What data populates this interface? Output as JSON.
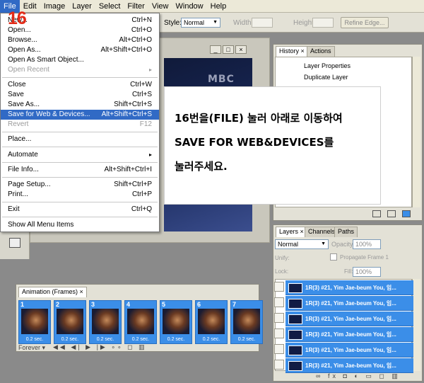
{
  "menubar": {
    "items": [
      "File",
      "Edit",
      "Image",
      "Layer",
      "Select",
      "Filter",
      "View",
      "Window",
      "Help"
    ]
  },
  "options": {
    "style_label": "Style:",
    "style_value": "Normal",
    "width_label": "Width:",
    "height_label": "Height:",
    "refine_edge": "Refine Edge..."
  },
  "file_menu": {
    "items": [
      {
        "label": "New...",
        "shortcut": "Ctrl+N"
      },
      {
        "label": "Open...",
        "shortcut": "Ctrl+O"
      },
      {
        "label": "Browse...",
        "shortcut": "Alt+Ctrl+O"
      },
      {
        "label": "Open As...",
        "shortcut": "Alt+Shift+Ctrl+O"
      },
      {
        "label": "Open As Smart Object...",
        "shortcut": ""
      },
      {
        "label": "Open Recent",
        "shortcut": "▸"
      },
      {
        "label": "Close",
        "shortcut": "Ctrl+W"
      },
      {
        "label": "Save",
        "shortcut": "Ctrl+S"
      },
      {
        "label": "Save As...",
        "shortcut": "Shift+Ctrl+S"
      },
      {
        "label": "Save for Web & Devices...",
        "shortcut": "Alt+Shift+Ctrl+S"
      },
      {
        "label": "Revert",
        "shortcut": "F12"
      },
      {
        "label": "Place...",
        "shortcut": ""
      },
      {
        "label": "Automate",
        "shortcut": "▸"
      },
      {
        "label": "File Info...",
        "shortcut": "Alt+Shift+Ctrl+I"
      },
      {
        "label": "Page Setup...",
        "shortcut": "Shift+Ctrl+P"
      },
      {
        "label": "Print...",
        "shortcut": "Ctrl+P"
      },
      {
        "label": "Exit",
        "shortcut": "Ctrl+Q"
      },
      {
        "label": "Show All Menu Items",
        "shortcut": ""
      }
    ]
  },
  "badge": "16",
  "callout": {
    "line1": "16번을(FILE) 눌러 아래로 이동하여",
    "line2": "SAVE FOR WEB&DEVICES를",
    "line3": "눌러주세요."
  },
  "history_panel": {
    "tabs": [
      "History",
      "Actions"
    ],
    "rows": [
      "Layer Properties",
      "Duplicate Layer"
    ]
  },
  "layers_panel": {
    "tabs": [
      "Layers",
      "Channels",
      "Paths"
    ],
    "blend_mode": "Normal",
    "opacity_label": "Opacity:",
    "opacity_value": "100%",
    "unify_label": "Unify:",
    "propagate_label": "Propagate Frame 1",
    "lock_label": "Lock:",
    "fill_label": "Fill:",
    "fill_value": "100%",
    "layers": [
      "1R(3) #21, Yim Jae-beum  You, 임...",
      "1R(3) #21, Yim Jae-beum  You, 임...",
      "1R(3) #21, Yim Jae-beum  You, 임...",
      "1R(3) #21, Yim Jae-beum  You, 임...",
      "1R(3) #21, Yim Jae-beum  You, 임...",
      "1R(3) #21, Yim Jae-beum  You, 임..."
    ]
  },
  "animation_panel": {
    "title": "Animation (Frames)",
    "frames": [
      {
        "num": "1",
        "delay": "0.2 sec."
      },
      {
        "num": "2",
        "delay": "0.2 sec."
      },
      {
        "num": "3",
        "delay": "0.2 sec."
      },
      {
        "num": "4",
        "delay": "0.2 sec."
      },
      {
        "num": "5",
        "delay": "0.2 sec."
      },
      {
        "num": "6",
        "delay": "0.2 sec."
      },
      {
        "num": "7",
        "delay": "0.2 sec."
      }
    ],
    "loop": "Forever"
  },
  "doc_watermark": "MBC",
  "colors": {
    "highlight": "#316ac5",
    "layer_selected": "#3b8ee8",
    "badge_red": "#e22a17"
  }
}
